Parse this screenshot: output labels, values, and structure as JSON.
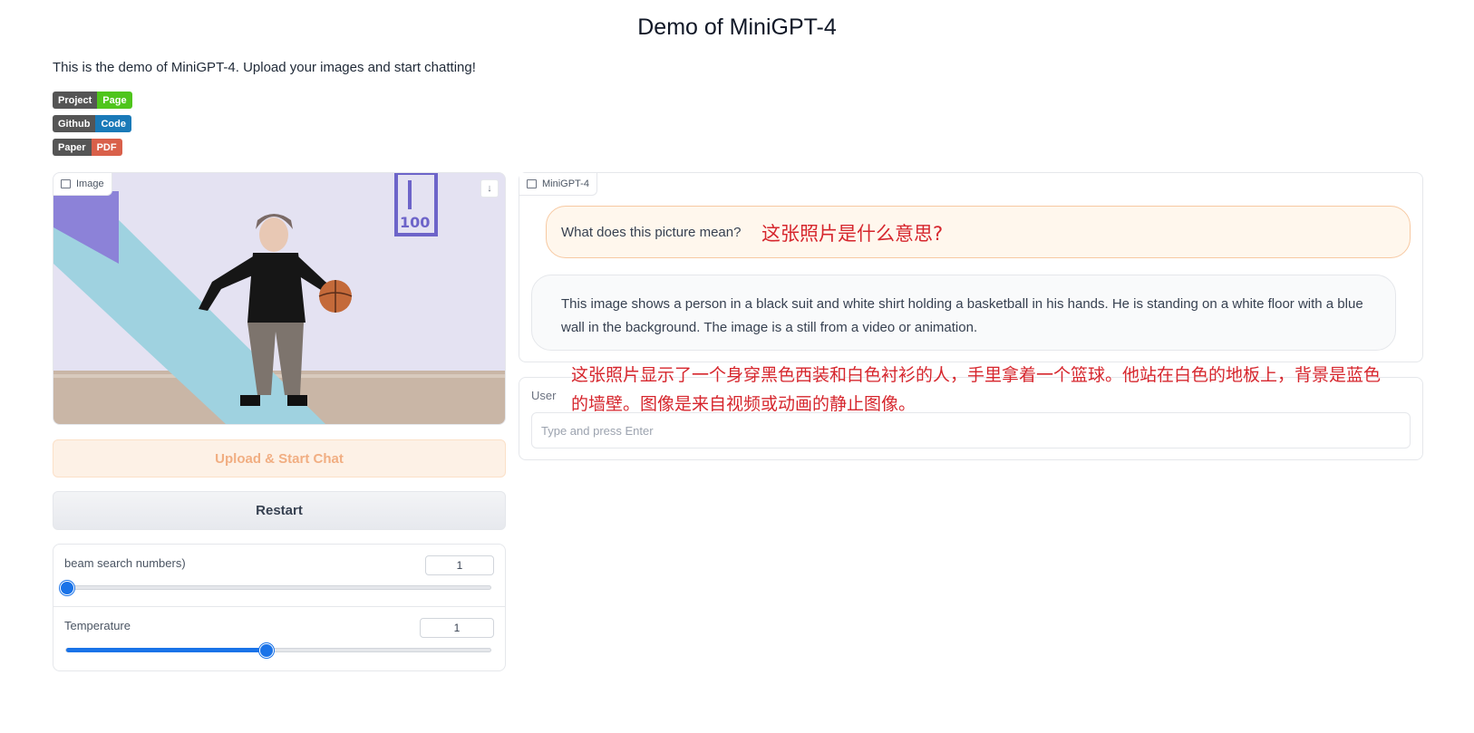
{
  "app": {
    "title": "Demo of MiniGPT-4",
    "description": "This is the demo of MiniGPT-4. Upload your images and start chatting!"
  },
  "badges": [
    {
      "key": "Project",
      "value": "Page",
      "color": "#4fc51c"
    },
    {
      "key": "Github",
      "value": "Code",
      "color": "#1a7ab8"
    },
    {
      "key": "Paper",
      "value": "PDF",
      "color": "#d9604a"
    }
  ],
  "image_panel": {
    "label": "Image",
    "icon": "image-icon",
    "download_icon": "download-icon"
  },
  "buttons": {
    "upload": "Upload & Start Chat",
    "restart": "Restart"
  },
  "settings": {
    "beam": {
      "label": "beam search numbers)",
      "value": "1",
      "fraction": 0.0
    },
    "temperature": {
      "label": "Temperature",
      "value": "1",
      "fraction": 0.47
    }
  },
  "chat": {
    "label": "MiniGPT-4",
    "icon": "chat-icon",
    "user_message": "What does this picture mean?",
    "bot_message": "This image shows a person in a black suit and white shirt holding a basketball in his hands. He is standing on a white floor with a blue wall in the background. The image is a still from a video or animation."
  },
  "user_input": {
    "label": "User",
    "placeholder": "Type and press Enter",
    "value": ""
  },
  "annotations": {
    "question_zh": "这张照片是什么意思?",
    "answer_zh": "这张照片显示了一个身穿黑色西装和白色衬衫的人，手里拿着一个篮球。他站在白色的地板上，背景是蓝色的墙壁。图像是来自视频或动画的静止图像。"
  },
  "colors": {
    "accent": "#1a73e8",
    "annotation": "#d6262d",
    "upload_bg": "#fdf1e6"
  }
}
